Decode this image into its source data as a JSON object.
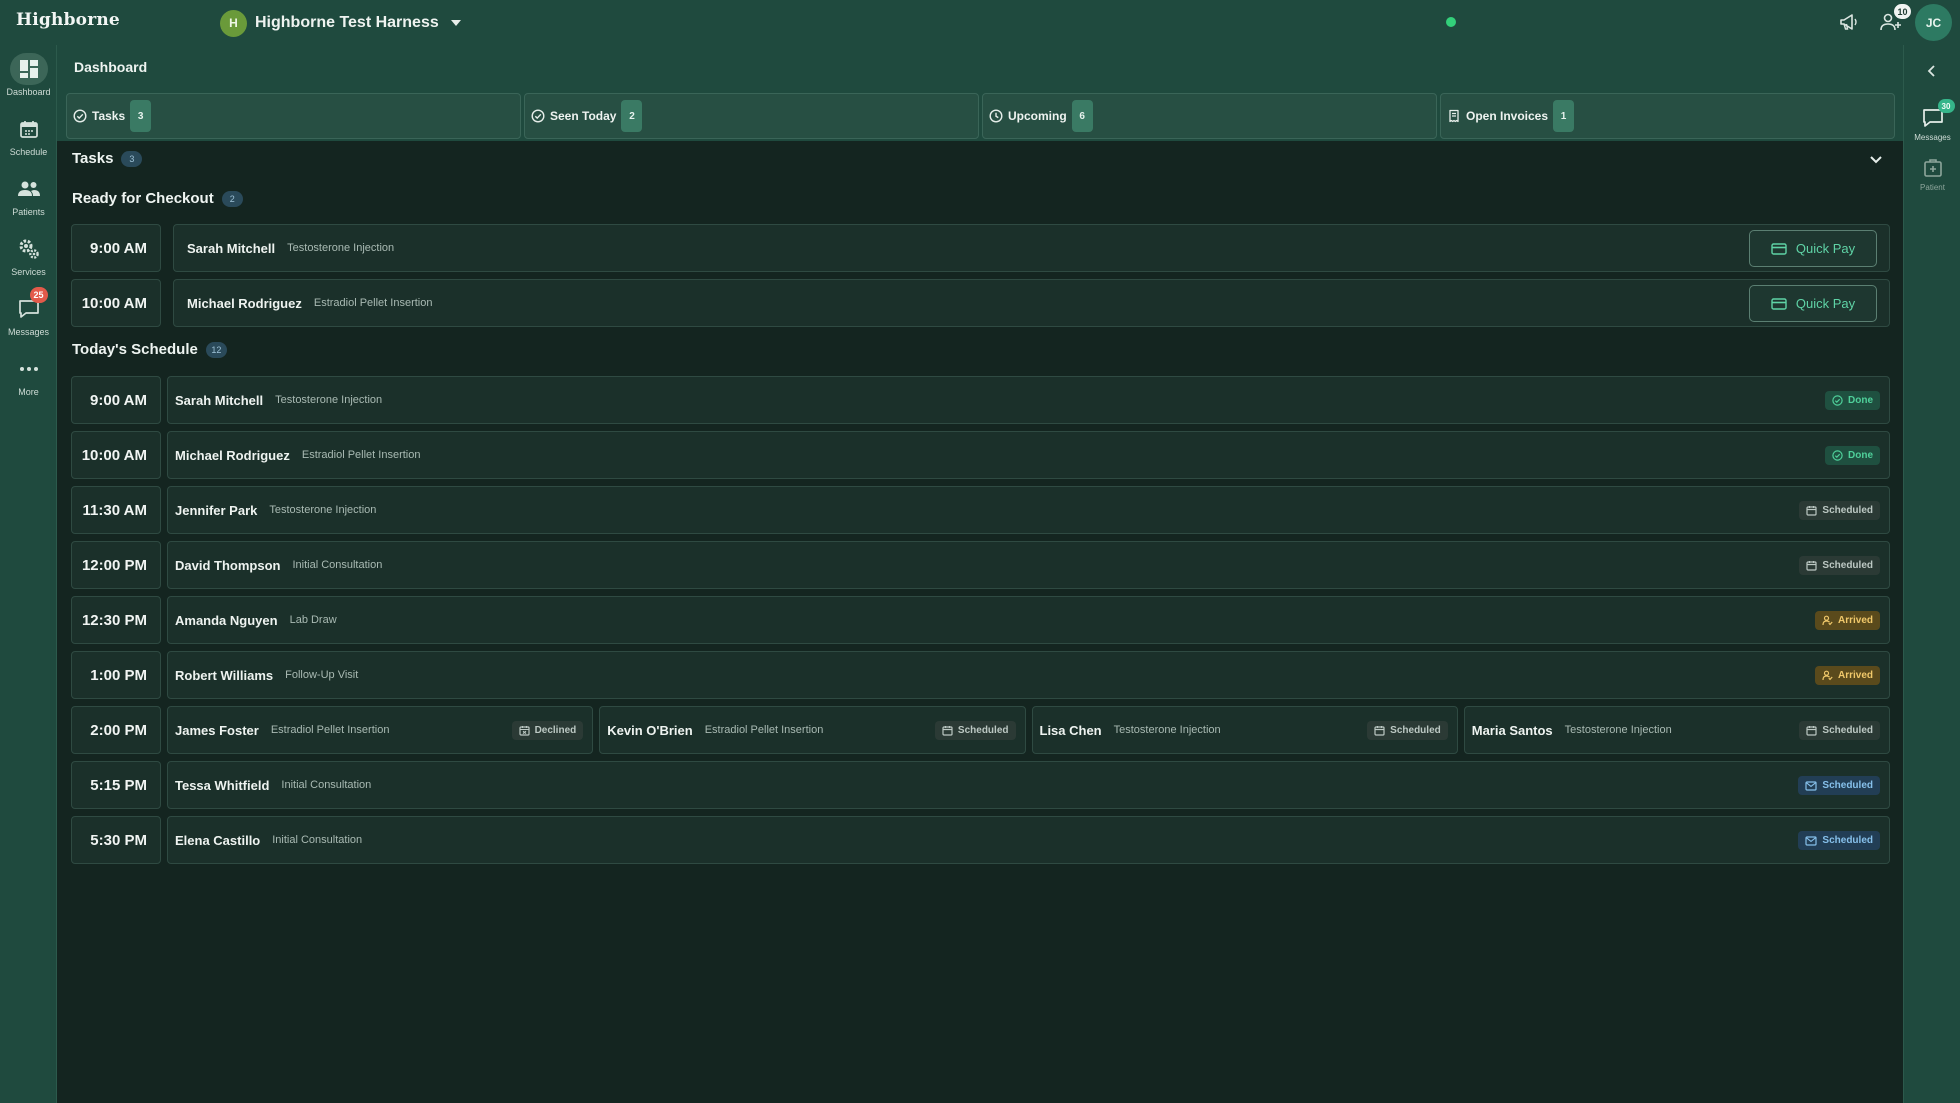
{
  "app": {
    "brand": "Highborne"
  },
  "org": {
    "initial": "H",
    "name": "Highborne Test Harness"
  },
  "topbar": {
    "status_color": "#33d07a",
    "announce_icon": "megaphone-icon",
    "users_icon": "users-icon",
    "users_badge": "10",
    "user_initials": "JC"
  },
  "leftnav": [
    {
      "label": "Dashboard",
      "icon": "dashboard-icon",
      "active": true
    },
    {
      "label": "Schedule",
      "icon": "calendar-icon"
    },
    {
      "label": "Patients",
      "icon": "patients-icon"
    },
    {
      "label": "Services",
      "icon": "gear-icon"
    },
    {
      "label": "Messages",
      "icon": "chat-icon",
      "badge": "25"
    },
    {
      "label": "More",
      "icon": "more-icon"
    }
  ],
  "rightrail": {
    "messages": {
      "label": "Messages",
      "badge": "30"
    },
    "patient": {
      "label": "Patient"
    }
  },
  "page": {
    "title": "Dashboard"
  },
  "stats": [
    {
      "label": "Tasks",
      "count": "3",
      "icon": "check-circle-icon"
    },
    {
      "label": "Seen Today",
      "count": "2",
      "icon": "check-circle-icon"
    },
    {
      "label": "Upcoming",
      "count": "6",
      "icon": "clock-icon"
    },
    {
      "label": "Open Invoices",
      "count": "1",
      "icon": "invoice-icon"
    }
  ],
  "tasks": {
    "title": "Tasks",
    "count": "3",
    "ready": {
      "title": "Ready for Checkout",
      "count": "2",
      "button_label": "Quick Pay",
      "items": [
        {
          "time": "9:00 AM",
          "name": "Sarah Mitchell",
          "service": "Testosterone Injection"
        },
        {
          "time": "10:00 AM",
          "name": "Michael Rodriguez",
          "service": "Estradiol Pellet Insertion"
        }
      ]
    }
  },
  "schedule": {
    "title": "Today's Schedule",
    "count": "12",
    "rows": [
      {
        "time": "9:00 AM",
        "appts": [
          {
            "name": "Sarah Mitchell",
            "service": "Testosterone Injection",
            "status": "Done",
            "kind": "done"
          }
        ]
      },
      {
        "time": "10:00 AM",
        "appts": [
          {
            "name": "Michael Rodriguez",
            "service": "Estradiol Pellet Insertion",
            "status": "Done",
            "kind": "done"
          }
        ]
      },
      {
        "time": "11:30 AM",
        "appts": [
          {
            "name": "Jennifer Park",
            "service": "Testosterone Injection",
            "status": "Scheduled",
            "kind": "scheduled"
          }
        ]
      },
      {
        "time": "12:00 PM",
        "appts": [
          {
            "name": "David Thompson",
            "service": "Initial Consultation",
            "status": "Scheduled",
            "kind": "scheduled"
          }
        ]
      },
      {
        "time": "12:30 PM",
        "appts": [
          {
            "name": "Amanda Nguyen",
            "service": "Lab Draw",
            "status": "Arrived",
            "kind": "arrived"
          }
        ]
      },
      {
        "time": "1:00 PM",
        "appts": [
          {
            "name": "Robert Williams",
            "service": "Follow-Up Visit",
            "status": "Arrived",
            "kind": "arrived"
          }
        ]
      },
      {
        "time": "2:00 PM",
        "appts": [
          {
            "name": "James Foster",
            "service": "Estradiol Pellet Insertion",
            "status": "Declined",
            "kind": "declined"
          },
          {
            "name": "Kevin O'Brien",
            "service": "Estradiol Pellet Insertion",
            "status": "Scheduled",
            "kind": "scheduled"
          },
          {
            "name": "Lisa Chen",
            "service": "Testosterone Injection",
            "status": "Scheduled",
            "kind": "scheduled"
          },
          {
            "name": "Maria Santos",
            "service": "Testosterone Injection",
            "status": "Scheduled",
            "kind": "scheduled"
          }
        ]
      },
      {
        "time": "5:15 PM",
        "appts": [
          {
            "name": "Tessa Whitfield",
            "service": "Initial Consultation",
            "status": "Scheduled",
            "kind": "sched-blue"
          }
        ]
      },
      {
        "time": "5:30 PM",
        "appts": [
          {
            "name": "Elena Castillo",
            "service": "Initial Consultation",
            "status": "Scheduled",
            "kind": "sched-blue"
          }
        ]
      }
    ]
  }
}
